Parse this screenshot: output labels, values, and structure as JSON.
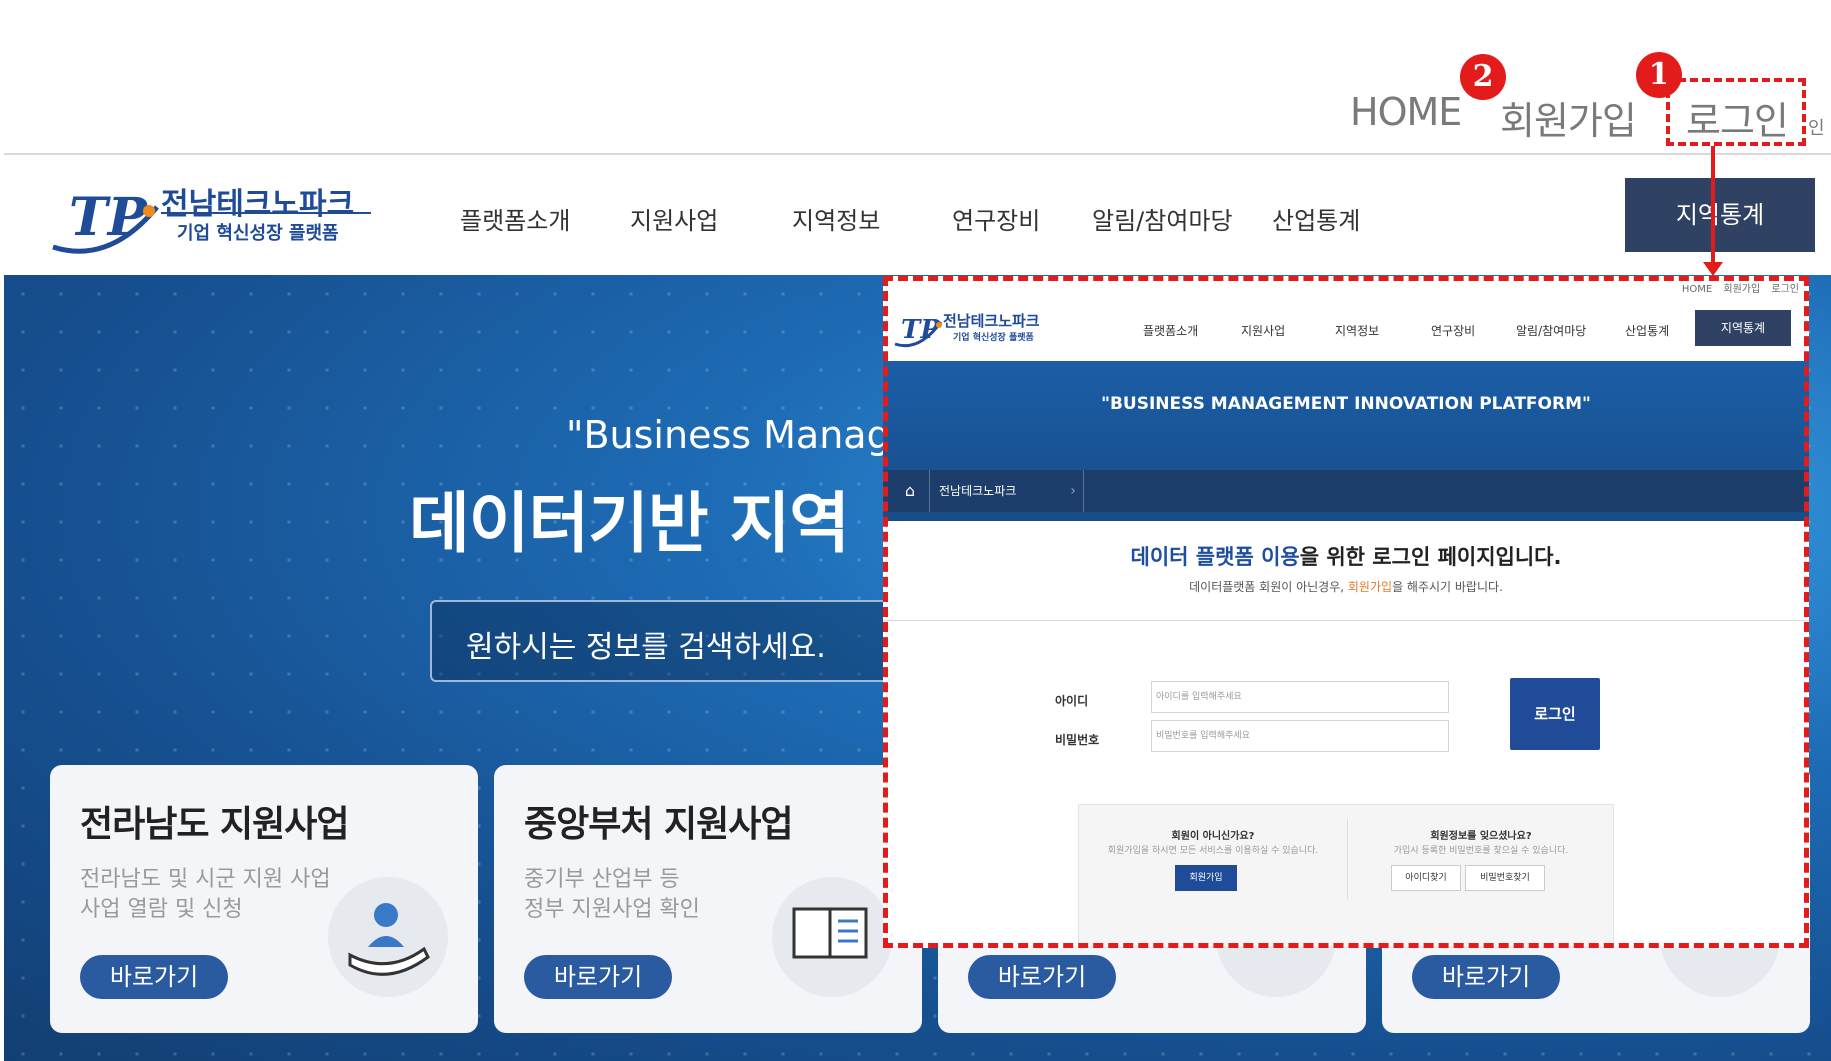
{
  "topnav": {
    "home": "HOME",
    "join": "회원가입",
    "login": "로그인",
    "login_tail": "인",
    "badge1": "1",
    "badge2": "2"
  },
  "header": {
    "logo_text": "전남테크노파크",
    "logo_sub": "기업 혁신성장 플랫폼",
    "logo_mark": "TP",
    "menu": [
      "플랫폼소개",
      "지원사업",
      "지역정보",
      "연구장비",
      "알림/참여마당",
      "산업통계",
      "지역통계"
    ]
  },
  "hero": {
    "subtitle": "\"Business Manager",
    "title": "데이터기반 지역",
    "search_placeholder": "원하시는 정보를 검색하세요.",
    "cards": [
      {
        "title": "전라남도 지원사업",
        "desc1": "전라남도 및 시군 지원 사업",
        "desc2": "사업 열람 및 신청",
        "button": "바로가기",
        "icon": "hand-person-icon"
      },
      {
        "title": "중앙부처 지원사업",
        "desc1": "중기부 산업부 등",
        "desc2": "정부 지원사업 확인",
        "button": "바로가기",
        "icon": "book-pen-icon"
      },
      {
        "button": "바로가기",
        "icon": "building-icon"
      },
      {
        "button": "바로가기",
        "icon": "lab-icon"
      }
    ]
  },
  "overlay": {
    "top_links": [
      "HOME",
      "회원가입",
      "로그인"
    ],
    "logo_text": "전남테크노파크",
    "logo_sub": "기업 혁신성장 플랫폼",
    "menu": [
      "플랫폼소개",
      "지원사업",
      "지역정보",
      "연구장비",
      "알림/참여마당",
      "산업통계",
      "지역통계"
    ],
    "band_text": "\"BUSINESS MANAGEMENT INNOVATION PLATFORM\"",
    "breadcrumb": "전남테크노파크",
    "msg_highlight": "데이터 플랫폼 이용",
    "msg_rest": "을 위한 로그인 페이지입니다.",
    "msg2_pre": "데이터플랫폼 회원이 아닌경우, ",
    "msg2_link": "회원가입",
    "msg2_post": "을 해주시기 바랍니다.",
    "id_label": "아이디",
    "id_placeholder": "아이디를 입력해주세요",
    "pw_label": "비밀번호",
    "pw_placeholder": "비밀번호를 입력해주세요",
    "login_button": "로그인",
    "box1_title": "회원이 아니신가요?",
    "box1_desc": "회원가입을 하시면 모든 서비스를 이용하실 수 있습니다.",
    "box1_button": "회원가입",
    "box2_title": "회원정보를 잊으셨나요?",
    "box2_desc": "가입시 등록한 비밀번호를 찾으실 수 있습니다.",
    "box2_button1": "아이디찾기",
    "box2_button2": "비밀번호찾기"
  },
  "colors": {
    "accent_red": "#e31b1b",
    "navy": "#2f4263",
    "brand_blue": "#1f4b99"
  }
}
